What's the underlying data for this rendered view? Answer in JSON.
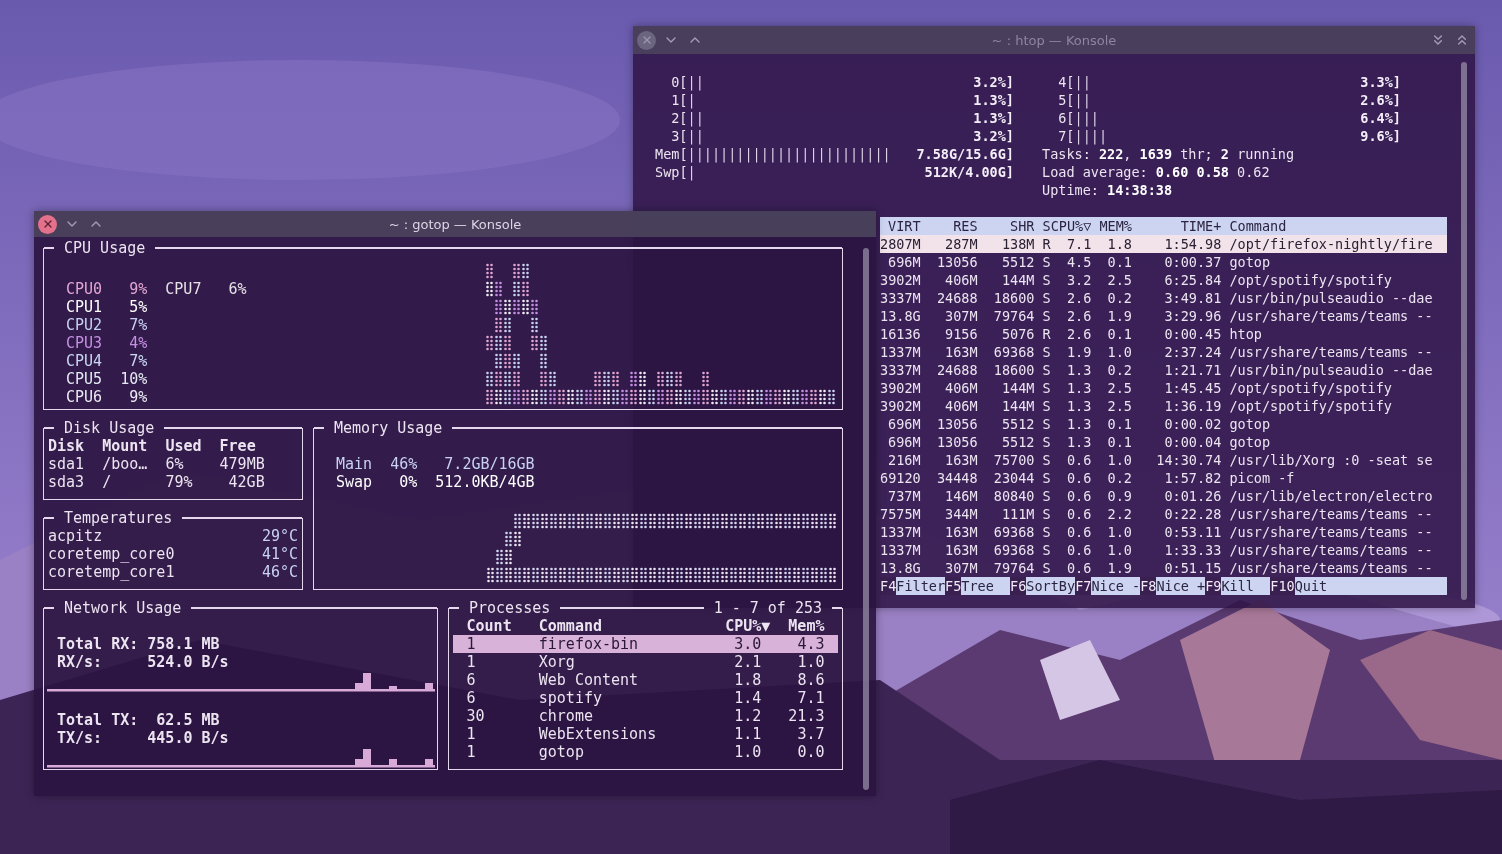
{
  "htop": {
    "window": {
      "title": "~ : htop — Konsole",
      "active": false
    },
    "meters_left": [
      {
        "label": "0[",
        "bars": "||",
        "value": "3.2%]"
      },
      {
        "label": "1[",
        "bars": "|",
        "value": "1.3%]"
      },
      {
        "label": "2[",
        "bars": "||",
        "value": "1.3%]"
      },
      {
        "label": "3[",
        "bars": "||",
        "value": "3.2%]"
      },
      {
        "label": "Mem[",
        "bars": "|||||||||||||||||||||||||",
        "value": "7.58G/15.6G]"
      },
      {
        "label": "Swp[",
        "bars": "|",
        "value": "512K/4.00G]"
      }
    ],
    "meters_right": [
      {
        "label": "4[",
        "bars": "||",
        "value": "3.3%]"
      },
      {
        "label": "5[",
        "bars": "||",
        "value": "2.6%]"
      },
      {
        "label": "6[",
        "bars": "|||",
        "value": "6.4%]"
      },
      {
        "label": "7[",
        "bars": "||||",
        "value": "9.6%]"
      }
    ],
    "summary": [
      "Tasks: **222**, **1639** thr; **2** running",
      "Load average: **0.60** **0.58** 0.62",
      "Uptime: **14:38:38**"
    ],
    "columns": [
      "VIRT",
      "RES",
      "SHR",
      "S",
      "CPU%▽",
      "MEM%",
      "TIME+",
      "Command"
    ],
    "rows": [
      {
        "cells": [
          "2807M",
          "287M",
          "138M",
          "R",
          "7.1",
          "1.8",
          "1:54.98",
          "/opt/firefox-nightly/fire"
        ],
        "selected": true
      },
      {
        "cells": [
          "696M",
          "13056",
          "5512",
          "S",
          "4.5",
          "0.1",
          "0:00.37",
          "gotop"
        ],
        "selected": false
      },
      {
        "cells": [
          "3902M",
          "406M",
          "144M",
          "S",
          "3.2",
          "2.5",
          "6:25.84",
          "/opt/spotify/spotify"
        ],
        "selected": false
      },
      {
        "cells": [
          "3337M",
          "24688",
          "18600",
          "S",
          "2.6",
          "0.2",
          "3:49.81",
          "/usr/bin/pulseaudio --dae"
        ],
        "selected": false
      },
      {
        "cells": [
          "13.8G",
          "307M",
          "79764",
          "S",
          "2.6",
          "1.9",
          "3:29.96",
          "/usr/share/teams/teams --"
        ],
        "selected": false
      },
      {
        "cells": [
          "16136",
          "9156",
          "5076",
          "R",
          "2.6",
          "0.1",
          "0:00.45",
          "htop"
        ],
        "selected": false
      },
      {
        "cells": [
          "1337M",
          "163M",
          "69368",
          "S",
          "1.9",
          "1.0",
          "2:37.24",
          "/usr/share/teams/teams --"
        ],
        "selected": false
      },
      {
        "cells": [
          "3337M",
          "24688",
          "18600",
          "S",
          "1.3",
          "0.2",
          "1:21.71",
          "/usr/bin/pulseaudio --dae"
        ],
        "selected": false
      },
      {
        "cells": [
          "3902M",
          "406M",
          "144M",
          "S",
          "1.3",
          "2.5",
          "1:45.45",
          "/opt/spotify/spotify"
        ],
        "selected": false
      },
      {
        "cells": [
          "3902M",
          "406M",
          "144M",
          "S",
          "1.3",
          "2.5",
          "1:36.19",
          "/opt/spotify/spotify"
        ],
        "selected": false
      },
      {
        "cells": [
          "696M",
          "13056",
          "5512",
          "S",
          "1.3",
          "0.1",
          "0:00.02",
          "gotop"
        ],
        "selected": false
      },
      {
        "cells": [
          "696M",
          "13056",
          "5512",
          "S",
          "1.3",
          "0.1",
          "0:00.04",
          "gotop"
        ],
        "selected": false
      },
      {
        "cells": [
          "216M",
          "163M",
          "75700",
          "S",
          "0.6",
          "1.0",
          "14:30.74",
          "/usr/lib/Xorg :0 -seat se"
        ],
        "selected": false
      },
      {
        "cells": [
          "69120",
          "34448",
          "23044",
          "S",
          "0.6",
          "0.2",
          "1:57.82",
          "picom -f"
        ],
        "selected": false
      },
      {
        "cells": [
          "737M",
          "146M",
          "80840",
          "S",
          "0.6",
          "0.9",
          "0:01.26",
          "/usr/lib/electron/electro"
        ],
        "selected": false
      },
      {
        "cells": [
          "7575M",
          "344M",
          "111M",
          "S",
          "0.6",
          "2.2",
          "0:22.28",
          "/usr/share/teams/teams --"
        ],
        "selected": false
      },
      {
        "cells": [
          "1337M",
          "163M",
          "69368",
          "S",
          "0.6",
          "1.0",
          "0:53.11",
          "/usr/share/teams/teams --"
        ],
        "selected": false
      },
      {
        "cells": [
          "1337M",
          "163M",
          "69368",
          "S",
          "0.6",
          "1.0",
          "1:33.33",
          "/usr/share/teams/teams --"
        ],
        "selected": false
      },
      {
        "cells": [
          "13.8G",
          "307M",
          "79764",
          "S",
          "0.6",
          "1.9",
          "0:51.15",
          "/usr/share/teams/teams --"
        ],
        "selected": false
      }
    ],
    "function_keys": [
      {
        "key": "F4",
        "label": "Filter"
      },
      {
        "key": "F5",
        "label": "Tree"
      },
      {
        "key": "F6",
        "label": "SortBy"
      },
      {
        "key": "F7",
        "label": "Nice -"
      },
      {
        "key": "F8",
        "label": "Nice +"
      },
      {
        "key": "F9",
        "label": "Kill"
      },
      {
        "key": "F10",
        "label": "Quit"
      }
    ]
  },
  "gotop": {
    "window": {
      "title": "~ : gotop — Konsole",
      "active": true
    },
    "cpu_panel": {
      "title": "CPU Usage",
      "cpus": [
        {
          "name": "CPU0",
          "value": "9%",
          "color": "#e2a6d2"
        },
        {
          "name": "CPU1",
          "value": "5%",
          "color": "#ffffff"
        },
        {
          "name": "CPU2",
          "value": "7%",
          "color": "#c8d2f2"
        },
        {
          "name": "CPU3",
          "value": "4%",
          "color": "#c690e2"
        },
        {
          "name": "CPU4",
          "value": "7%",
          "color": "#cad8f2"
        },
        {
          "name": "CPU5",
          "value": "10%",
          "color": "#e4eaf2"
        },
        {
          "name": "CPU6",
          "value": "9%",
          "color": "#eceaf2"
        },
        {
          "name": "CPU7",
          "value": "6%",
          "color": "#e6e2e6"
        }
      ]
    },
    "disk_panel": {
      "title": "Disk Usage",
      "columns": [
        "Disk",
        "Mount",
        "Used",
        "Free"
      ],
      "rows": [
        [
          "sda1",
          "/boo…",
          "6%",
          "479MB"
        ],
        [
          "sda3",
          "/",
          "79%",
          "42GB"
        ]
      ]
    },
    "temperature_panel": {
      "title": "Temperatures",
      "rows": [
        {
          "name": "acpitz",
          "value": "29°C"
        },
        {
          "name": "coretemp_core0",
          "value": "41°C"
        },
        {
          "name": "coretemp_core1",
          "value": "46°C"
        }
      ]
    },
    "memory_panel": {
      "title": "Memory Usage",
      "rows": [
        {
          "name": "Main",
          "percent": "46%",
          "amount": "7.2GB/16GB",
          "color": "#c8d2f2"
        },
        {
          "name": "Swap",
          "percent": "0%",
          "amount": "512.0KB/4GB",
          "color": "#ffffff"
        }
      ]
    },
    "network_panel": {
      "title": "Network Usage",
      "groups": [
        {
          "lines": [
            {
              "label": "Total RX:",
              "value": "758.1",
              "unit": "MB"
            },
            {
              "label": "RX/s:",
              "value": "524.0",
              "unit": "B/s"
            }
          ]
        },
        {
          "lines": [
            {
              "label": "Total TX:",
              "value": "62.5",
              "unit": "MB"
            },
            {
              "label": "TX/s:",
              "value": "445.0",
              "unit": "B/s"
            }
          ]
        }
      ]
    },
    "process_panel": {
      "title": "Processes",
      "range": "1 - 7 of 253",
      "columns": [
        "Count",
        "Command",
        "CPU%▼",
        "Mem%"
      ],
      "rows": [
        {
          "count": "1",
          "command": "firefox-bin",
          "cpu": "3.0",
          "mem": "4.3",
          "selected": true
        },
        {
          "count": "1",
          "command": "Xorg",
          "cpu": "2.1",
          "mem": "1.0",
          "selected": false
        },
        {
          "count": "6",
          "command": "Web Content",
          "cpu": "1.8",
          "mem": "8.6",
          "selected": false
        },
        {
          "count": "6",
          "command": "spotify",
          "cpu": "1.4",
          "mem": "7.1",
          "selected": false
        },
        {
          "count": "30",
          "command": "chrome",
          "cpu": "1.2",
          "mem": "21.3",
          "selected": false
        },
        {
          "count": "1",
          "command": "WebExtensions",
          "cpu": "1.1",
          "mem": "3.7",
          "selected": false
        },
        {
          "count": "1",
          "command": "gotop",
          "cpu": "1.0",
          "mem": "0.0",
          "selected": false
        }
      ]
    }
  }
}
